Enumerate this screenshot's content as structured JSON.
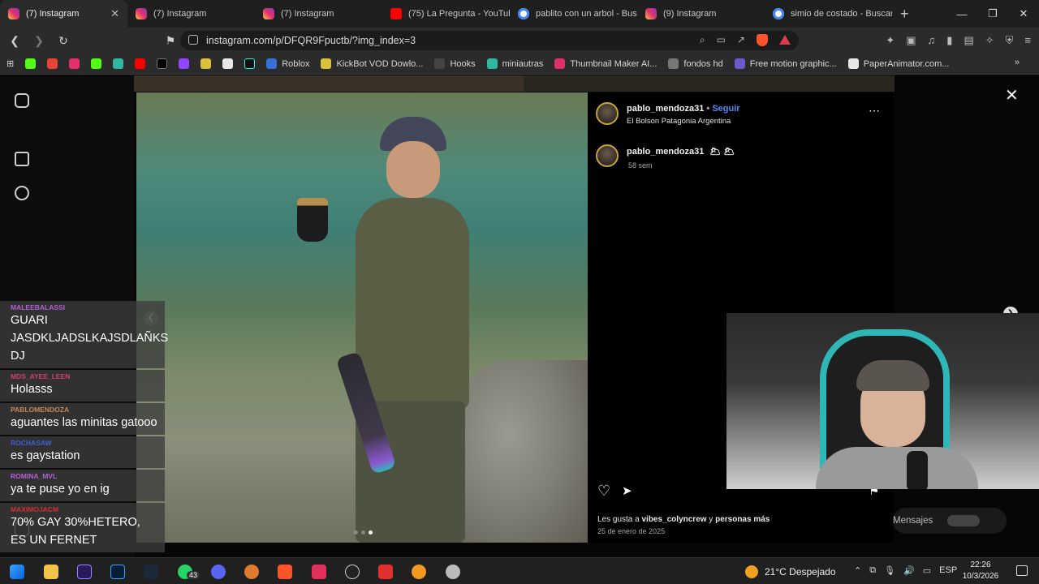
{
  "tabs": [
    {
      "label": "(7) Instagram",
      "icon": "instagram-icon",
      "active": true
    },
    {
      "label": "(7) Instagram",
      "icon": "instagram-icon"
    },
    {
      "label": "(7) Instagram",
      "icon": "instagram-icon"
    },
    {
      "label": "(75) La Pregunta - YouTub",
      "icon": "youtube-icon"
    },
    {
      "label": "pablito con un arbol - Bus",
      "icon": "google-icon"
    },
    {
      "label": "(9) Instagram",
      "icon": "instagram-icon"
    },
    {
      "label": "simio de costado - Buscar",
      "icon": "google-icon"
    }
  ],
  "address": {
    "url": "instagram.com/p/DFQR9Fpuctb/?img_index=3"
  },
  "bookmarks": [
    {
      "label": "Roblox",
      "color": "#3b6fd8"
    },
    {
      "label": "KickBot VOD Dowlo...",
      "color": "#d8c13b"
    },
    {
      "label": "Hooks",
      "color": "#444444"
    },
    {
      "label": "miniautras",
      "color": "#2fb7a0"
    },
    {
      "label": "Thumbnail Maker AI...",
      "color": "#e0306c"
    },
    {
      "label": "fondos hd",
      "color": "#777777"
    },
    {
      "label": "Free motion graphic...",
      "color": "#6a5acd"
    },
    {
      "label": "PaperAnimator.com...",
      "color": "#e8e8e8"
    }
  ],
  "post": {
    "header_user": "pablo_mendoza31",
    "follow_label": "Seguir",
    "location": "El Bolson Patagonia Argentina",
    "caption_user": "pablo_mendoza31",
    "caption_emojis": "🌥 🌥",
    "caption_time": "58 sem",
    "likes_prefix": "Les gusta a ",
    "likes_user": "vibes_colyncrew",
    "likes_join": " y ",
    "likes_others": "personas más",
    "date": "25 de enero de 2025",
    "more_icon": "more-dots-icon"
  },
  "chat": [
    {
      "user": "MALEEBALASSI",
      "text": "GUARI JASDKLJADSLKAJSDLAÑKS DJ",
      "color": "#b060d0"
    },
    {
      "user": "MDS_AYEE_LEEN",
      "text": "Holasss",
      "color": "#d04070"
    },
    {
      "user": "PABLOMENDOZA",
      "text": "aguantes las minitas gatooo",
      "color": "#c08a60"
    },
    {
      "user": "ROCHASAW",
      "text": "es gaystation",
      "color": "#4060d0"
    },
    {
      "user": "ROMINA_MVL",
      "text": "ya te puse yo en ig",
      "color": "#b060d0"
    },
    {
      "user": "MAXIMOJACM",
      "text": "70% GAY 30%HETERO, ES UN FERNET",
      "color": "#d03030"
    }
  ],
  "messages_label": "Mensajes",
  "taskbar": {
    "badge_count": "43",
    "weather": "21°C  Despejado",
    "lang": "ESP",
    "time": "22:26",
    "date": "10/3/2026"
  }
}
